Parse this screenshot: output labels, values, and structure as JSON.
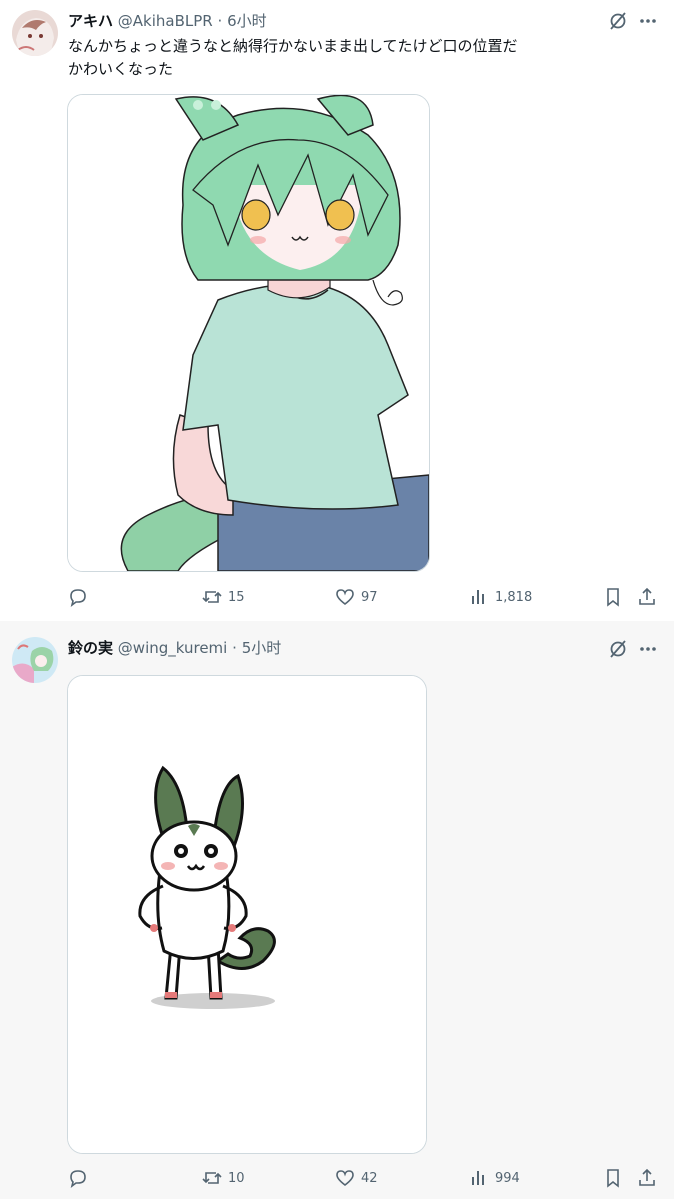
{
  "tweets": [
    {
      "display_name": "アキハ",
      "handle": "@AkihaBLPR",
      "separator": "·",
      "time": "6小时",
      "text": "なんかちょっと違うなと納得行かないまま出してたけど口の位置だかわいくなった",
      "text_line1": "なんかちょっと違うなと納得行かないまま出してたけど口の位置だ",
      "text_line2": "かわいくなった",
      "retweets": "15",
      "likes": "97",
      "views": "1,818"
    },
    {
      "display_name": "鈴の実",
      "handle": "@wing_kuremi",
      "separator": "·",
      "time": "5小时",
      "retweets": "10",
      "likes": "42",
      "views": "994"
    }
  ],
  "icons": {
    "reply": "reply-icon",
    "retweet": "retweet-icon",
    "like": "heart-icon",
    "views": "analytics-icon",
    "bookmark": "bookmark-icon",
    "share": "share-icon",
    "grok": "grok-icon",
    "more": "more-icon"
  },
  "colors": {
    "text": "#0f1419",
    "secondary": "#536471",
    "border": "#cfd9de",
    "alt_background": "#f7f7f7"
  }
}
